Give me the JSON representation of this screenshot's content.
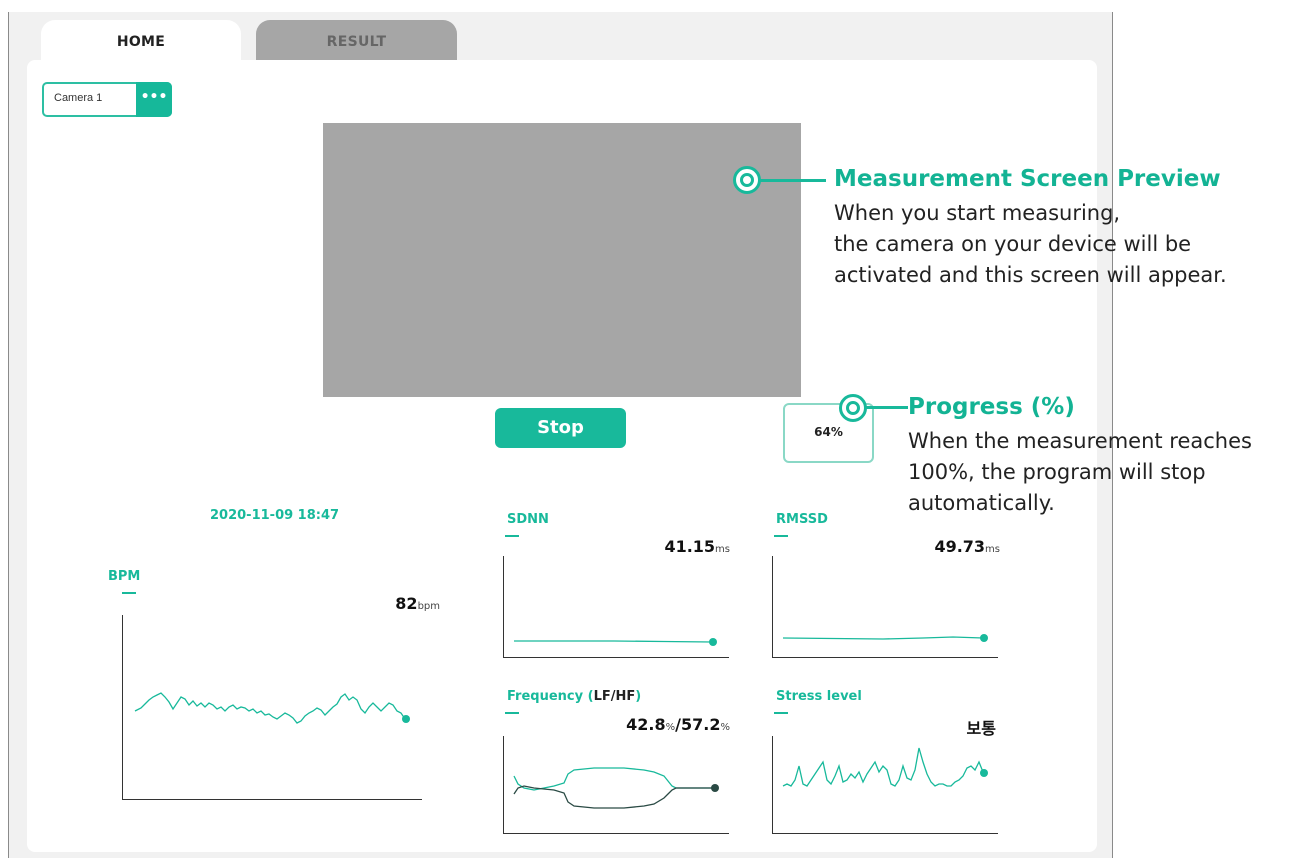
{
  "tabs": [
    {
      "label": "HOME"
    },
    {
      "label": "RESULT"
    }
  ],
  "camera": {
    "selected": "Camera 1",
    "more_label": "•••"
  },
  "controls": {
    "stop_label": "Stop"
  },
  "progress": {
    "label": "64%",
    "value": 0.64
  },
  "datetime": "2020-11-09 18:47",
  "annotations": {
    "preview": {
      "title": "Measurement Screen Preview",
      "lines": [
        "When you start measuring,",
        "the camera on your device will be",
        "activated and this screen will appear."
      ]
    },
    "progress": {
      "title": "Progress (%)",
      "lines": [
        "When the measurement reaches",
        "100%, the program will stop",
        "automatically."
      ]
    }
  },
  "metrics": {
    "bpm": {
      "title": "BPM",
      "value": "82",
      "unit": "bpm"
    },
    "sdnn": {
      "title": "SDNN",
      "value": "41.15",
      "unit": "ms"
    },
    "rmssd": {
      "title": "RMSSD",
      "value": "49.73",
      "unit": "ms"
    },
    "frequency": {
      "title_prefix": "Frequency (",
      "title_lf_hf": "LF/HF",
      "title_suffix": ")",
      "lf": "42.8",
      "hf": "57.2",
      "unit": "%",
      "separator": "/"
    },
    "stress": {
      "title": "Stress level",
      "value": "보통"
    }
  },
  "colors": {
    "accent": "#18b99b",
    "preview_gray": "#a6a6a6",
    "tab_inactive": "#a6a6a6"
  }
}
